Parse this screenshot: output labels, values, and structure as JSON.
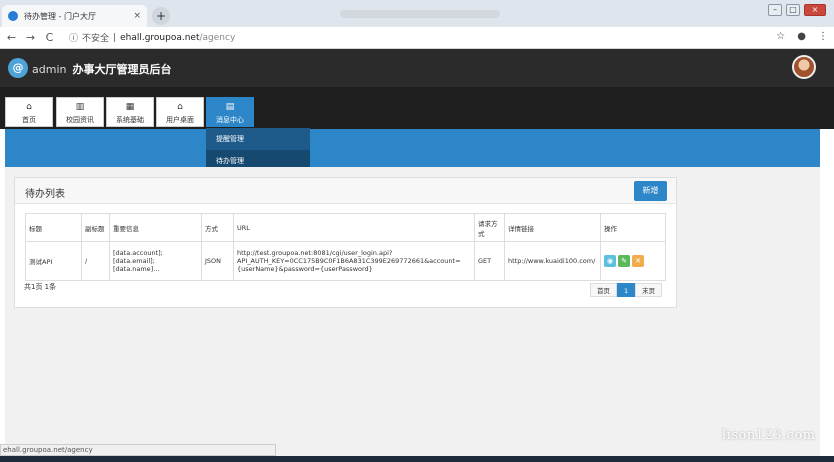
{
  "browser": {
    "tab_title": "待办管理 - 门户大厅",
    "tab_close": "×",
    "new_tab": "+",
    "insecure_label": "不安全",
    "url_host": "ehall.groupoa.net",
    "url_path": "/agency",
    "window_buttons": [
      "–",
      "□",
      "×"
    ],
    "status_url": "ehall.groupoa.net/agency"
  },
  "app": {
    "logo_text": "admin",
    "title": "办事大厅管理员后台"
  },
  "nav": {
    "tabs": [
      {
        "label": "首页",
        "icon": "home-icon"
      },
      {
        "label": "校园资讯",
        "icon": "chart-icon"
      },
      {
        "label": "系统基础",
        "icon": "grid-icon"
      },
      {
        "label": "用户桌面",
        "icon": "home-icon"
      },
      {
        "label": "消息中心",
        "icon": "table-icon"
      }
    ],
    "active": "消息中心",
    "dropdown": [
      "提醒管理",
      "待办管理"
    ],
    "dropdown_selected": "待办管理"
  },
  "panel": {
    "title": "待办列表",
    "add_label": "新增",
    "columns": [
      "标题",
      "副标题",
      "重要信息",
      "方式",
      "URL",
      "请求方式",
      "详情链接",
      "操作"
    ],
    "rows": [
      {
        "title": "测试API",
        "subtitle": "/",
        "info": "[data.account];\n[data.email];\n[data.name]...",
        "method": "JSON",
        "url": "http://test.groupoa.net:8081/cgi/user_login.api?\nAPI_AUTH_KEY=0CC175B9C0F1B6A831C399E269772661&account=\n{userName}&password={userPassword}",
        "request": "GET",
        "detail": "http://www.kuaidi100.com/"
      }
    ],
    "summary": "共1页 1条",
    "pager": {
      "first": "首页",
      "current": "1",
      "last": "末页"
    }
  },
  "watermark": "lison123.com"
}
